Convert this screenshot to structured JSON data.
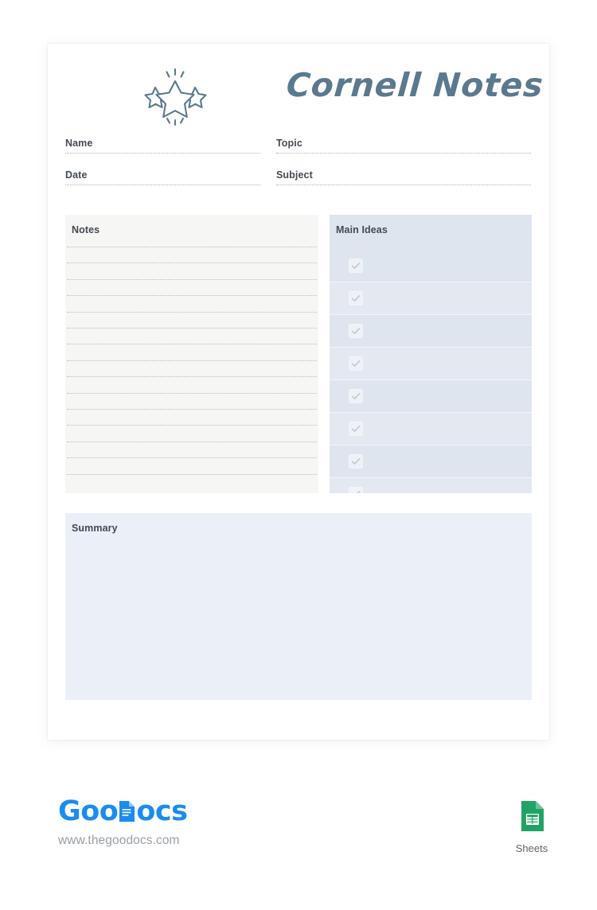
{
  "document": {
    "title": "Cornell Notes",
    "logo_icon": "three-stars-icon"
  },
  "fields": [
    {
      "label": "Name",
      "value": "",
      "placeholder": ""
    },
    {
      "label": "Topic",
      "value": "",
      "placeholder": ""
    },
    {
      "label": "Date",
      "value": "",
      "placeholder": ""
    },
    {
      "label": "Subject",
      "value": "",
      "placeholder": ""
    }
  ],
  "notes": {
    "heading": "Notes",
    "line_count": 15,
    "background": "#f6f6f5",
    "rule_color": "#b3bcc6"
  },
  "main_ideas": {
    "heading": "Main Ideas",
    "row_count": 8,
    "checkbox_icon": "checkmark-icon",
    "background": "#dfe5ef",
    "alt_background": "#e3e8f1"
  },
  "summary": {
    "heading": "Summary",
    "value": "",
    "background": "#ebf0f8"
  },
  "footer": {
    "brand_part1": "Goo",
    "brand_part2": "ocs",
    "brand_icon": "document-icon",
    "url": "www.thegoodocs.com",
    "app_badge": {
      "label": "Sheets",
      "icon": "google-sheets-icon",
      "color": "#21a366"
    }
  },
  "colors": {
    "title": "#5a798f",
    "heading_text": "#434a54",
    "brand_blue": "#1a8cf0",
    "url_gray": "#9aa0a6",
    "sheets_green": "#21a366"
  }
}
